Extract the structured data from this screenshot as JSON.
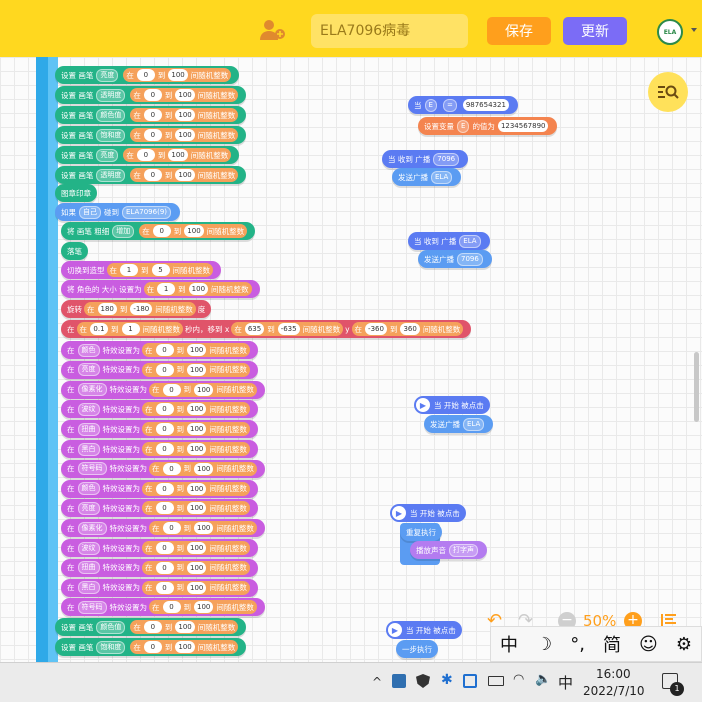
{
  "header": {
    "project_name": "ELA7096病毒",
    "save_label": "保存",
    "update_label": "更新",
    "avatar_text": "ELA"
  },
  "zoom": {
    "value": "50%"
  },
  "common": {
    "pen_set": "设置 画笔",
    "in": "在",
    "to": "到",
    "random": "间随机整数",
    "effect_set": "特效设置为"
  },
  "script_main": {
    "pen_rows": [
      {
        "prop": "亮度",
        "a": "0",
        "b": "100"
      },
      {
        "prop": "透明度",
        "a": "0",
        "b": "100"
      },
      {
        "prop": "颜色值",
        "a": "0",
        "b": "100"
      },
      {
        "prop": "饱和度",
        "a": "0",
        "b": "100"
      },
      {
        "prop": "亮度",
        "a": "0",
        "b": "100"
      },
      {
        "prop": "透明度",
        "a": "0",
        "b": "100"
      }
    ],
    "stamp": "图章印章",
    "if_label": "如果",
    "if_self": "自己",
    "if_touch": "碰到",
    "if_target": "ELA7096(9)",
    "pen_size_label": "将 画笔 粗细",
    "pen_size_op": "增加",
    "pen_size_a": "0",
    "pen_size_b": "100",
    "pen_up": "落笔",
    "costume_label": "切换到造型",
    "costume_a": "1",
    "costume_b": "5",
    "size_label": "将 角色的 大小 设置为",
    "size_a": "1",
    "size_b": "100",
    "rotate_label": "旋转",
    "rotate_a": "180",
    "rotate_b": "-180",
    "rotate_unit": "度",
    "glide_in": "在",
    "glide_a": "0.1",
    "glide_b": "1",
    "glide_mid": "秒内，移到 x",
    "glide_x1": "635",
    "glide_x2": "-635",
    "glide_y": "y",
    "glide_y1": "-360",
    "glide_y2": "360",
    "effect_rows": [
      {
        "effect": "颜色",
        "a": "0",
        "b": "100"
      },
      {
        "effect": "亮度",
        "a": "0",
        "b": "100"
      },
      {
        "effect": "像素化",
        "a": "0",
        "b": "100"
      },
      {
        "effect": "波纹",
        "a": "0",
        "b": "100"
      },
      {
        "effect": "扭曲",
        "a": "0",
        "b": "100"
      },
      {
        "effect": "黑白",
        "a": "0",
        "b": "100"
      },
      {
        "effect": "符号码",
        "a": "0",
        "b": "100"
      },
      {
        "effect": "颜色",
        "a": "0",
        "b": "100"
      },
      {
        "effect": "亮度",
        "a": "0",
        "b": "100"
      },
      {
        "effect": "像素化",
        "a": "0",
        "b": "100"
      },
      {
        "effect": "波纹",
        "a": "0",
        "b": "100"
      },
      {
        "effect": "扭曲",
        "a": "0",
        "b": "100"
      },
      {
        "effect": "黑白",
        "a": "0",
        "b": "100"
      },
      {
        "effect": "符号码",
        "a": "0",
        "b": "100"
      }
    ],
    "tail_rows": [
      {
        "prop": "颜色值",
        "a": "0",
        "b": "100"
      },
      {
        "prop": "饱和度",
        "a": "0",
        "b": "100"
      }
    ]
  },
  "script_var": {
    "when": "当",
    "var": "E",
    "op": "=",
    "value": "987654321",
    "set_label": "设置变量",
    "set_var": "E",
    "set_mid": "的值为",
    "set_value": "1234567890"
  },
  "script_bc1": {
    "when": "当 收到 广播",
    "msg": "7096",
    "send": "发送广播",
    "send_msg": "ELA"
  },
  "script_bc2": {
    "when": "当 收到 广播",
    "msg": "ELA",
    "send": "发送广播",
    "send_msg": "7096"
  },
  "script_flag1": {
    "when": "当 开始 被点击",
    "send": "发送广播",
    "send_msg": "ELA"
  },
  "script_flag2": {
    "when": "当 开始 被点击",
    "loop": "重复执行",
    "play": "播放声音",
    "sound": "打字声"
  },
  "script_flag3": {
    "when": "当 开始 被点击",
    "step": "一步执行"
  },
  "ime": {
    "chinese": "中",
    "punct": "°,",
    "simp": "简"
  },
  "taskbar": {
    "ime_lang": "中",
    "time": "16:00",
    "date": "2022/7/10",
    "notif_count": "1"
  },
  "colors": {
    "topbar": "#ffd81f",
    "save": "#ff9f1c",
    "update": "#7b6cf6",
    "pen": "#23b387",
    "looks": "#c95de0",
    "operator": "#f5a15b",
    "control": "#5b9cf2"
  }
}
